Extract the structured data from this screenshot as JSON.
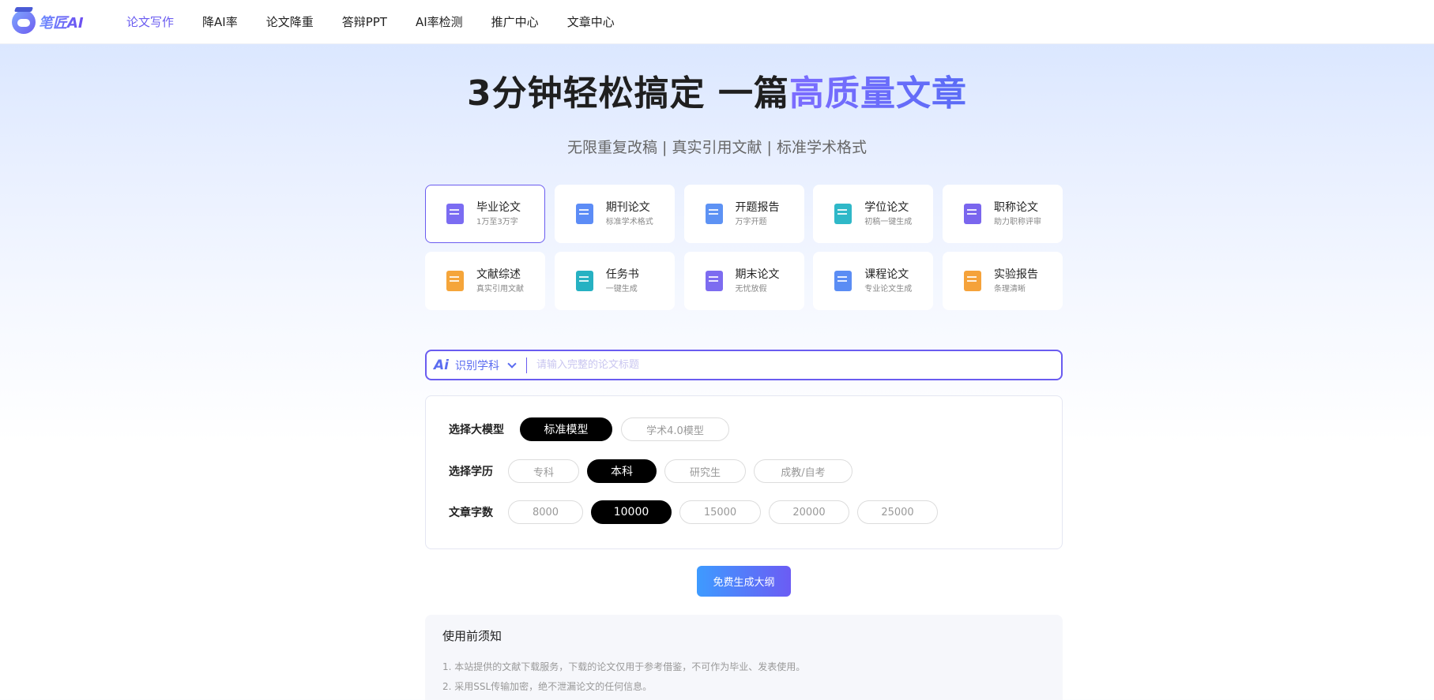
{
  "logo": {
    "text": "笔匠AI"
  },
  "nav": {
    "items": [
      {
        "label": "论文写作",
        "active": true
      },
      {
        "label": "降AI率"
      },
      {
        "label": "论文降重"
      },
      {
        "label": "答辩PPT"
      },
      {
        "label": "AI率检测"
      },
      {
        "label": "推广中心"
      },
      {
        "label": "文章中心"
      }
    ],
    "active_color": "#6a5cf0"
  },
  "hero": {
    "title_main": "3分钟轻松搞定 一篇",
    "title_highlight": "高质量文章",
    "subtitle": "无限重复改稿 | 真实引用文献 | 标准学术格式"
  },
  "cards": [
    {
      "title": "毕业论文",
      "desc": "1万至3万字",
      "icon": "graduation-cap-icon",
      "color": "#7b6cf2",
      "active": true
    },
    {
      "title": "期刊论文",
      "desc": "标准学术格式",
      "icon": "journal-book-icon",
      "color": "#5c8cf6"
    },
    {
      "title": "开题报告",
      "desc": "万字开题",
      "icon": "report-document-icon",
      "color": "#5d92f4"
    },
    {
      "title": "学位论文",
      "desc": "初稿一键生成",
      "icon": "degree-cap-icon",
      "color": "#2fb8c8"
    },
    {
      "title": "职称论文",
      "desc": "助力职称评审",
      "icon": "profile-certificate-icon",
      "color": "#7a66ee"
    },
    {
      "title": "文献综述",
      "desc": "真实引用文献",
      "icon": "literature-folder-icon",
      "color": "#f5a53a"
    },
    {
      "title": "任务书",
      "desc": "一键生成",
      "icon": "task-clipboard-icon",
      "color": "#26b1c2"
    },
    {
      "title": "期末论文",
      "desc": "无忧放假",
      "icon": "calendar-icon",
      "color": "#7d6cf0"
    },
    {
      "title": "课程论文",
      "desc": "专业论文生成",
      "icon": "course-document-icon",
      "color": "#5b8df4"
    },
    {
      "title": "实验报告",
      "desc": "条理清晰",
      "icon": "experiment-report-icon",
      "color": "#f5a23a"
    }
  ],
  "search": {
    "ai_badge": "Ai",
    "subject_label": "识别学科",
    "placeholder": "请输入完整的论文标题"
  },
  "options": {
    "model": {
      "label": "选择大模型",
      "options": [
        "标准模型",
        "学术4.0模型"
      ],
      "selected": "标准模型"
    },
    "education": {
      "label": "选择学历",
      "options": [
        "专科",
        "本科",
        "研究生",
        "成教/自考"
      ],
      "selected": "本科"
    },
    "word_count": {
      "label": "文章字数",
      "options": [
        "8000",
        "10000",
        "15000",
        "20000",
        "25000"
      ],
      "selected": "10000"
    }
  },
  "generate_button": {
    "label": "免费生成大纲"
  },
  "notice": {
    "title": "使用前须知",
    "lines": [
      "1. 本站提供的文献下载服务，下载的论文仅用于参考借鉴，不可作为毕业、发表使用。",
      "2. 采用SSL传输加密，绝不泄漏论文的任何信息。"
    ]
  }
}
